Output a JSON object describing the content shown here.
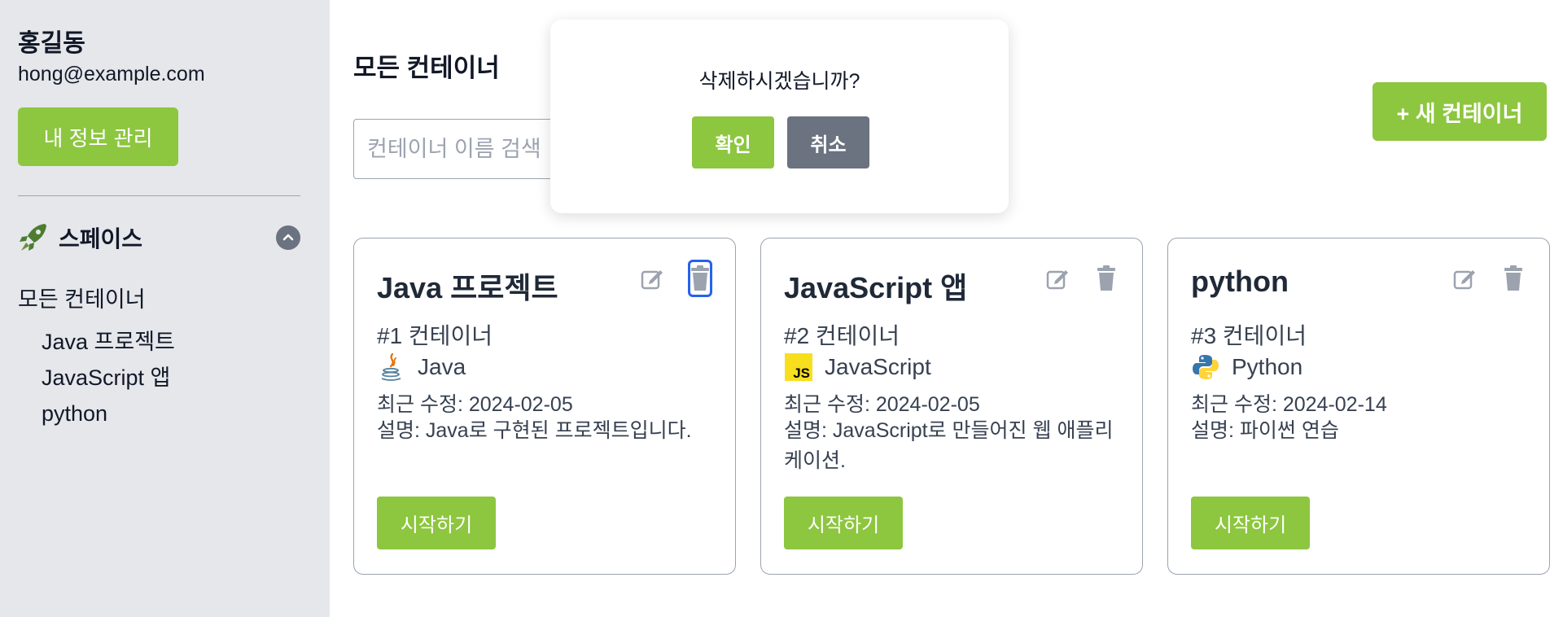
{
  "sidebar": {
    "user_name": "홍길동",
    "user_email": "hong@example.com",
    "profile_button": "내 정보 관리",
    "space_label": "스페이스",
    "all_containers": "모든 컨테이너",
    "items": [
      {
        "label": "Java 프로젝트"
      },
      {
        "label": "JavaScript 앱"
      },
      {
        "label": "python"
      }
    ]
  },
  "main": {
    "title": "모든 컨테이너",
    "search_placeholder": "컨테이너 이름 검색",
    "new_button": "+ 새 컨테이너",
    "cards": [
      {
        "title": "Java 프로젝트",
        "number": "#1 컨테이너",
        "language": "Java",
        "icon": "java-icon",
        "date": "최근 수정: 2024-02-05",
        "description": "설명: Java로 구현된 프로젝트입니다.",
        "start": "시작하기"
      },
      {
        "title": "JavaScript 앱",
        "number": "#2 컨테이너",
        "language": "JavaScript",
        "icon": "javascript-icon",
        "date": "최근 수정: 2024-02-05",
        "description": "설명: JavaScript로 만들어진 웹 애플리케이션.",
        "start": "시작하기"
      },
      {
        "title": "python",
        "number": "#3 컨테이너",
        "language": "Python",
        "icon": "python-icon",
        "date": "최근 수정: 2024-02-14",
        "description": "설명: 파이썬 연습",
        "start": "시작하기"
      }
    ]
  },
  "modal": {
    "message": "삭제하시겠습니까?",
    "confirm": "확인",
    "cancel": "취소"
  },
  "colors": {
    "accent": "#8dc63f",
    "gray_button": "#6b7280",
    "sidebar_bg": "#e5e7eb",
    "focus_ring": "#2563eb"
  }
}
